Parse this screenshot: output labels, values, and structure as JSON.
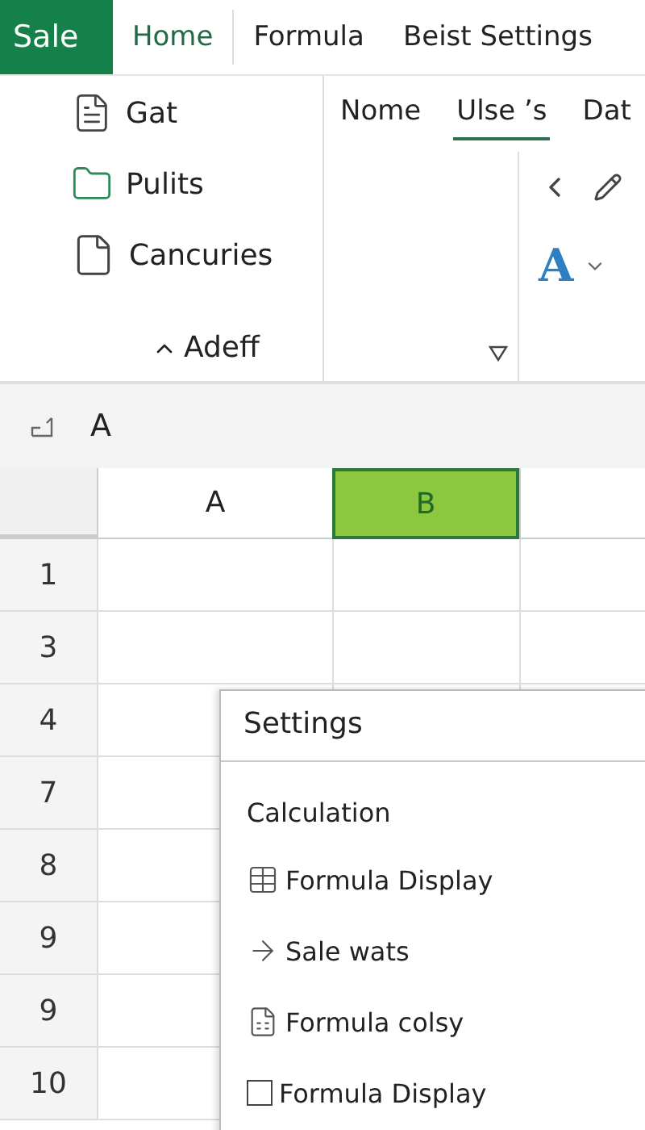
{
  "brand": {
    "label": "Sale"
  },
  "tabs": [
    {
      "label": "Home",
      "selected": true
    },
    {
      "label": "Formula",
      "selected": false
    },
    {
      "label": "Beist Settings",
      "selected": false
    }
  ],
  "ribbon": {
    "commands": [
      {
        "label": "Gat",
        "kind": "document"
      },
      {
        "label": "Pulits",
        "kind": "folder"
      },
      {
        "label": "Cancuries",
        "kind": "page"
      }
    ],
    "group_label": "Adeff",
    "subtabs": [
      {
        "label": "Nome",
        "selected": false
      },
      {
        "label": "Ulse ’s",
        "selected": true
      },
      {
        "label": "Dat",
        "selected": false
      }
    ],
    "font_color_label": "A"
  },
  "formula_bar": {
    "value": "A"
  },
  "grid": {
    "columns": [
      {
        "label": "A",
        "selected": false
      },
      {
        "label": "B",
        "selected": true
      }
    ],
    "rows": [
      "1",
      "3",
      "4",
      "7",
      "8",
      "9",
      "9",
      "10"
    ]
  },
  "settings": {
    "title": "Settings",
    "section": "Calculation",
    "items": [
      {
        "label": "Formula Display",
        "kind": "table"
      },
      {
        "label": "Sale wats",
        "kind": "arrow"
      },
      {
        "label": "Formula colsy",
        "kind": "document"
      },
      {
        "label": "Formula Display",
        "kind": "checkbox",
        "checked": false
      }
    ]
  }
}
